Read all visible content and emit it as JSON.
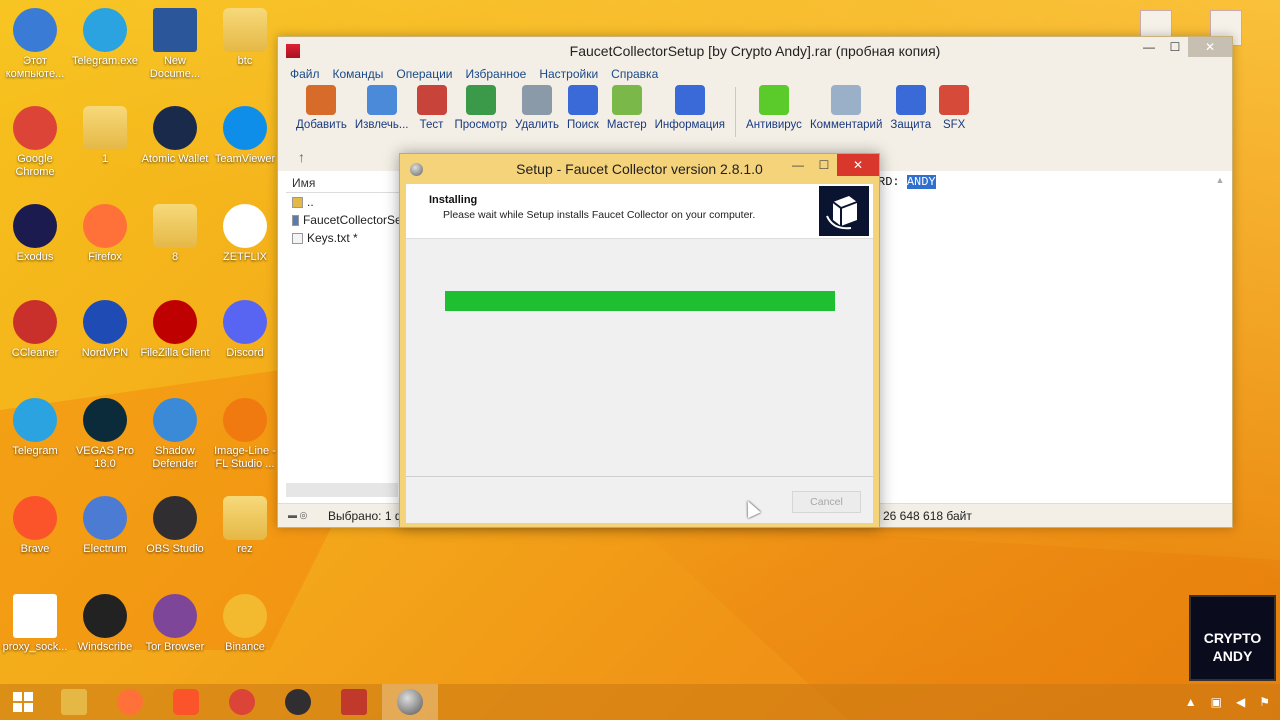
{
  "desktop": {
    "icons": [
      {
        "label": "Этот компьюте...",
        "icon": "computer-icon",
        "color": "#3a7bd5"
      },
      {
        "label": "Telegram.exe",
        "icon": "telegram-icon",
        "color": "#2aa3e0"
      },
      {
        "label": "New Docume...",
        "icon": "word-doc-icon",
        "color": "#2b579a"
      },
      {
        "label": "btc",
        "icon": "folder-icon",
        "color": "#e5b846"
      },
      {
        "label": "Google Chrome",
        "icon": "chrome-icon",
        "color": "#db4437"
      },
      {
        "label": "1",
        "icon": "folder-icon",
        "color": "#e5b846"
      },
      {
        "label": "Atomic Wallet",
        "icon": "atomic-wallet-icon",
        "color": "#1a2a4a"
      },
      {
        "label": "TeamViewer",
        "icon": "teamviewer-icon",
        "color": "#0e8ee9"
      },
      {
        "label": "Exodus",
        "icon": "exodus-icon",
        "color": "#1b1b4f"
      },
      {
        "label": "Firefox",
        "icon": "firefox-icon",
        "color": "#ff7139"
      },
      {
        "label": "8",
        "icon": "folder-icon",
        "color": "#e5b846"
      },
      {
        "label": "ZETFLIX",
        "icon": "zetflix-icon",
        "color": "#ffffff"
      },
      {
        "label": "CCleaner",
        "icon": "ccleaner-icon",
        "color": "#c9302c"
      },
      {
        "label": "NordVPN",
        "icon": "nordvpn-icon",
        "color": "#1f4bb4"
      },
      {
        "label": "FileZilla Client",
        "icon": "filezilla-icon",
        "color": "#bf0000"
      },
      {
        "label": "Discord",
        "icon": "discord-icon",
        "color": "#5865f2"
      },
      {
        "label": "Telegram",
        "icon": "telegram-icon",
        "color": "#2aa3e0"
      },
      {
        "label": "VEGAS Pro 18.0",
        "icon": "vegas-icon",
        "color": "#0b2a3a"
      },
      {
        "label": "Shadow Defender",
        "icon": "shadow-defender-icon",
        "color": "#3a8ad8"
      },
      {
        "label": "Image-Line -FL Studio ...",
        "icon": "fl-studio-icon",
        "color": "#f07a10"
      },
      {
        "label": "Brave",
        "icon": "brave-icon",
        "color": "#fb542b"
      },
      {
        "label": "Electrum",
        "icon": "electrum-icon",
        "color": "#4c7bd4"
      },
      {
        "label": "OBS Studio",
        "icon": "obs-icon",
        "color": "#302e31"
      },
      {
        "label": "rez",
        "icon": "folder-icon",
        "color": "#e5b846"
      },
      {
        "label": "proxy_sock...",
        "icon": "text-file-icon",
        "color": "#ffffff"
      },
      {
        "label": "Windscribe",
        "icon": "windscribe-icon",
        "color": "#222222"
      },
      {
        "label": "Tor Browser",
        "icon": "tor-icon",
        "color": "#7d4698"
      },
      {
        "label": "Binance",
        "icon": "binance-icon",
        "color": "#f3ba2f"
      }
    ]
  },
  "rar": {
    "title": "FaucetCollectorSetup [by Crypto Andy].rar (пробная копия)",
    "menu": [
      "Файл",
      "Команды",
      "Операции",
      "Избранное",
      "Настройки",
      "Справка"
    ],
    "toolbar": [
      {
        "label": "Добавить",
        "icon": "add-icon",
        "color": "#d66b2a"
      },
      {
        "label": "Извлечь...",
        "icon": "extract-icon",
        "color": "#4a8ad8"
      },
      {
        "label": "Тест",
        "icon": "test-icon",
        "color": "#c8443a"
      },
      {
        "label": "Просмотр",
        "icon": "view-book-icon",
        "color": "#3a9a4a"
      },
      {
        "label": "Удалить",
        "icon": "delete-icon",
        "color": "#8a9aa8"
      },
      {
        "label": "Поиск",
        "icon": "search-icon",
        "color": "#3a6ad8"
      },
      {
        "label": "Мастер",
        "icon": "wizard-icon",
        "color": "#7ab84a"
      },
      {
        "label": "Информация",
        "icon": "info-icon",
        "color": "#3a6ad8"
      }
    ],
    "toolbar2": [
      {
        "label": "Антивирус",
        "icon": "antivirus-icon",
        "color": "#5acb2a"
      },
      {
        "label": "Комментарий",
        "icon": "comment-icon",
        "color": "#9ab0c8"
      },
      {
        "label": "Защита",
        "icon": "shield-icon",
        "color": "#3a6ad8"
      },
      {
        "label": "SFX",
        "icon": "sfx-icon",
        "color": "#d64a3a"
      }
    ],
    "column_name": "Имя",
    "files": [
      {
        "name": "..",
        "icon": "folder-icon"
      },
      {
        "name": "FaucetCollectorSet",
        "icon": "exe-file-icon"
      },
      {
        "name": "Keys.txt *",
        "icon": "text-file-icon"
      }
    ],
    "view_text": "RD: ",
    "view_selected": "ANDY",
    "status_left": "Выбрано: 1 фа",
    "status_right": "26 648 618 байт"
  },
  "setup": {
    "title": "Setup - Faucet Collector version 2.8.1.0",
    "heading": "Installing",
    "subheading": "Please wait while Setup installs Faucet Collector on your computer.",
    "progress": 1.0,
    "progress_color": "#1fbf32",
    "cancel_label": "Cancel"
  },
  "watermark": {
    "line1": "CRYPTO",
    "line2": "ANDY"
  }
}
